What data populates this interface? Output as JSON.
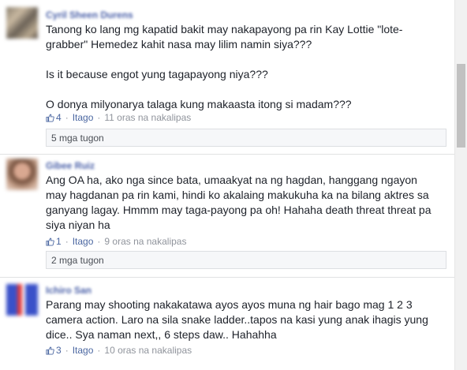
{
  "comments": [
    {
      "name": "Cyril Sheen Durens",
      "paragraphs": [
        "Tanong ko lang mg kapatid bakit may nakapayong pa rin Kay Lottie \"lote-grabber\" Hemedez kahit nasa may lilim namin siya???",
        "Is it because engot yung tagapayong niya???",
        "O donya milyonarya talaga kung makaasta itong si madam???"
      ],
      "likes": "4",
      "hide_label": "Itago",
      "time": "11 oras na nakalipas",
      "replies_label": "5 mga tugon"
    },
    {
      "name": "Gibee Ruiz",
      "paragraphs": [
        "Ang OA ha, ako nga since bata, umaakyat na ng hagdan, hanggang ngayon may hagdanan pa rin kami, hindi ko akalaing makukuha ka na bilang aktres sa ganyang lagay. Hmmm may taga-payong pa oh! Hahaha death threat threat pa siya niyan ha"
      ],
      "likes": "1",
      "hide_label": "Itago",
      "time": "9 oras na nakalipas",
      "replies_label": "2 mga tugon"
    },
    {
      "name": "Ichiro San",
      "paragraphs": [
        "Parang may shooting nakakatawa ayos ayos muna ng hair bago mag 1 2 3 camera action. Laro na sila snake ladder..tapos na kasi yung anak ihagis yung dice.. Sya naman next,, 6 steps daw.. Hahahha"
      ],
      "likes": "3",
      "hide_label": "Itago",
      "time": "10 oras na nakalipas"
    }
  ],
  "icons": {
    "like": "thumbs-up-icon"
  },
  "colors": {
    "link": "#4b67a1",
    "meta": "#90949c",
    "name": "#4a60a8"
  }
}
